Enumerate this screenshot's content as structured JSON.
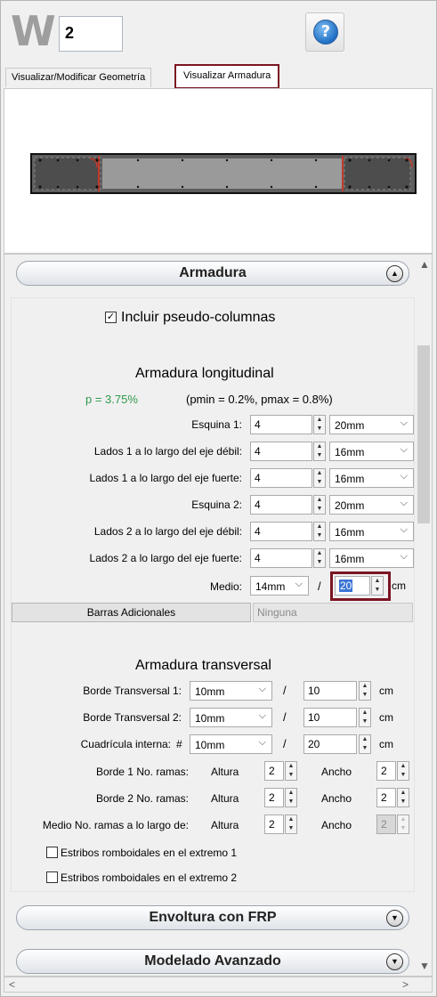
{
  "header": {
    "logo_letter": "W",
    "wall_number": "2",
    "help_glyph": "?"
  },
  "tabs": [
    "Visualizar/Modificar Geometría",
    "Visualizar Armadura"
  ],
  "sections": {
    "armadura": "Armadura",
    "envoltura": "Envoltura con FRP",
    "modelado": "Modelado Avanzado"
  },
  "pseudo_columns": {
    "label": "Incluir pseudo-columnas",
    "checked": true
  },
  "longitudinal": {
    "title": "Armadura longitudinal",
    "rho": "p = 3.75%",
    "rho_range": "(pmin = 0.2%, pmax = 0.8%)",
    "rows": [
      {
        "label": "Esquina 1:",
        "count": "4",
        "bar": "20mm"
      },
      {
        "label": "Lados 1 a lo largo del eje débil:",
        "count": "4",
        "bar": "16mm"
      },
      {
        "label": "Lados 1 a lo largo del eje fuerte:",
        "count": "4",
        "bar": "16mm"
      },
      {
        "label": "Esquina 2:",
        "count": "4",
        "bar": "20mm"
      },
      {
        "label": "Lados 2 a lo largo del eje débil:",
        "count": "4",
        "bar": "16mm"
      },
      {
        "label": "Lados 2 a lo largo del eje fuerte:",
        "count": "4",
        "bar": "16mm"
      }
    ],
    "medio": {
      "label": "Medio:",
      "bar": "14mm",
      "sep": "/",
      "spacing": "20",
      "unit": "cm"
    },
    "extra_bars": {
      "button": "Barras Adicionales",
      "value": "Ninguna"
    }
  },
  "transversal": {
    "title": "Armadura transversal",
    "rows": [
      {
        "label": "Borde Transversal 1:",
        "prefix": "",
        "bar": "10mm",
        "sep": "/",
        "spacing": "10",
        "unit": "cm"
      },
      {
        "label": "Borde Transversal 2:",
        "prefix": "",
        "bar": "10mm",
        "sep": "/",
        "spacing": "10",
        "unit": "cm"
      },
      {
        "label": "Cuadrícula interna:",
        "prefix": "#",
        "bar": "10mm",
        "sep": "/",
        "spacing": "20",
        "unit": "cm"
      }
    ],
    "legs": [
      {
        "label": "Borde 1 No. ramas:",
        "h_label": "Altura",
        "h": "2",
        "w_label": "Ancho",
        "w": "2"
      },
      {
        "label": "Borde 2 No. ramas:",
        "h_label": "Altura",
        "h": "2",
        "w_label": "Ancho",
        "w": "2"
      },
      {
        "label": "Medio No. ramas a lo largo de:",
        "h_label": "Altura",
        "h": "2",
        "w_label": "Ancho",
        "w": "2"
      }
    ],
    "rhomboid": [
      {
        "label": "Estribos romboidales en el extremo 1",
        "checked": false
      },
      {
        "label": "Estribos romboidales en el extremo 2",
        "checked": false
      }
    ]
  },
  "colors": {
    "highlight": "#7b1522",
    "rho": "#2e9a4a"
  }
}
